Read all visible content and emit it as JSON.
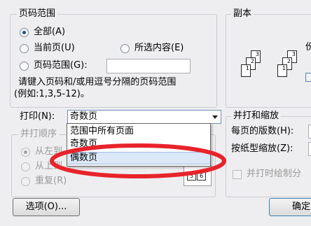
{
  "page_range": {
    "title": "页码范围",
    "all_label": "全部(A)",
    "current_label": "当前页(U)",
    "selection_label": "所选内容(E)",
    "pages_label": "页码范围(G):",
    "pages_value": "",
    "hint_line1": "请键入页码和/或用逗号分隔的页码范围",
    "hint_line2": "(例如:1,3,5-12)。"
  },
  "copies": {
    "title": "副本",
    "partial_text": "份",
    "page_numbers": [
      "3",
      "2",
      "1",
      "3",
      "2",
      "1"
    ]
  },
  "print": {
    "label": "打印(N):",
    "selected": "奇数页",
    "options": [
      "范围中所有页面",
      "奇数页",
      "偶数页"
    ],
    "highlighted_index": 2,
    "highlight_color": "#e8232a"
  },
  "print_order": {
    "title": "并打顺序",
    "option1": "从左到",
    "option2": "从上到",
    "option3": "重复(R)",
    "preview_numbers": [
      "5",
      "6"
    ]
  },
  "zoom": {
    "title": "并打和缩放",
    "pages_per_sheet_label": "每页的版数(H):",
    "scale_to_paper_label": "按纸型缩放(Z):",
    "draw_border_label": "并打时绘制分"
  },
  "buttons": {
    "options_label": "选项(O)...",
    "ok_label": "确定"
  }
}
